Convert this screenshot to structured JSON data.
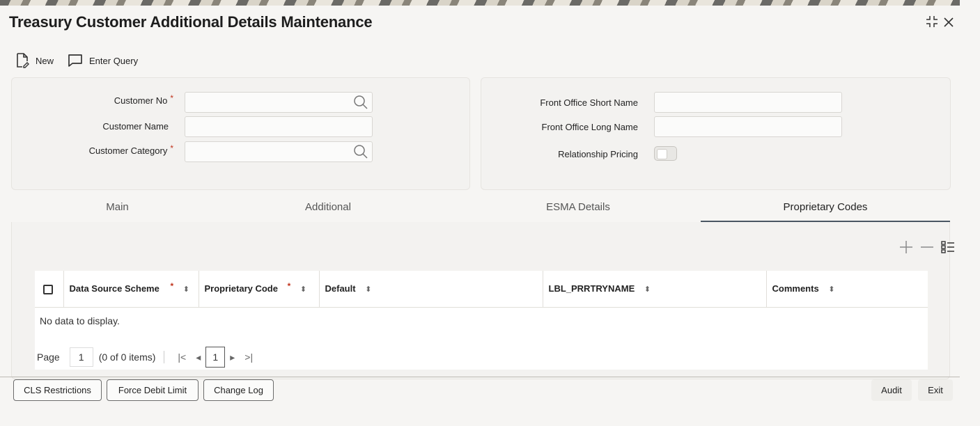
{
  "window": {
    "title": "Treasury Customer Additional Details Maintenance",
    "ctrl_icons": [
      "collapse-icon",
      "close-icon"
    ]
  },
  "toolbar": {
    "new_label": "New",
    "enter_query_label": "Enter Query"
  },
  "form": {
    "customer_no_label": "Customer No",
    "customer_name_label": "Customer Name",
    "customer_category_label": "Customer Category",
    "required_mark": "*",
    "fo_short_name_label": "Front Office Short Name",
    "fo_long_name_label": "Front Office Long Name",
    "relationship_pricing_label": "Relationship Pricing",
    "relationship_pricing_on": false,
    "customer_no_value": "",
    "customer_name_value": "",
    "customer_category_value": "",
    "fo_short_name_value": "",
    "fo_long_name_value": ""
  },
  "tabs": [
    {
      "label": "Main",
      "active": false
    },
    {
      "label": "Additional",
      "active": false
    },
    {
      "label": "ESMA Details",
      "active": false
    },
    {
      "label": "Proprietary Codes",
      "active": true
    }
  ],
  "grid": {
    "columns": [
      {
        "label": "Data Source Scheme",
        "required": true
      },
      {
        "label": "Proprietary Code",
        "required": true
      },
      {
        "label": "Default",
        "required": false
      },
      {
        "label": "LBL_PRRTRYNAME",
        "required": false
      },
      {
        "label": "Comments",
        "required": false
      }
    ],
    "empty_text": "No data to display.",
    "pager": {
      "page_label": "Page",
      "page_value": "1",
      "items_text": "(0 of 0 items)",
      "current_page": "1"
    }
  },
  "footer": {
    "cls_restrictions": "CLS Restrictions",
    "force_debit_limit": "Force Debit Limit",
    "change_log": "Change Log",
    "audit": "Audit",
    "exit": "Exit"
  }
}
